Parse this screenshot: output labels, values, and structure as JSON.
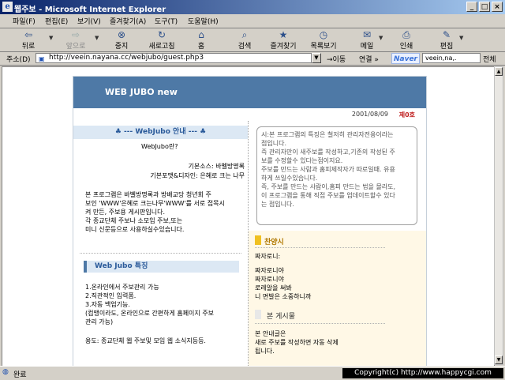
{
  "window": {
    "title": "웹주보 - Microsoft Internet Explorer",
    "minimize": "_",
    "maximize": "□",
    "close": "×"
  },
  "menu": [
    "파일(F)",
    "편집(E)",
    "보기(V)",
    "즐겨찾기(A)",
    "도구(T)",
    "도움말(H)"
  ],
  "toolbar": {
    "back": "뒤로",
    "forward": "앞으로",
    "stop": "중지",
    "refresh": "새로고침",
    "home": "홈",
    "search": "검색",
    "favorites": "즐겨찾기",
    "history": "목록보기",
    "mail": "메일",
    "print": "인쇄",
    "edit": "편집"
  },
  "address": {
    "label": "주소(D)",
    "url": "http://veein.nayana.cc/webjubo/guest.php3",
    "go": "이동",
    "links": "연결 »",
    "naver_logo": "Naver",
    "naver_search": "veein,na,.",
    "all": "전체"
  },
  "page": {
    "banner_title": "WEB JUBO new",
    "date": "2001/08/09",
    "issue": "제0호",
    "left": {
      "heading": "♣ --- WebJubo 안내 --- ♣",
      "question": "WebJubo란?",
      "source": "기본소스: 바벨방명록",
      "font": "기본포맷&디자인: 은혜로 크는 나무",
      "intro": "본 프로그램은 바벨방명록과 방배교당 청년회 주\n보인 'WWW'은혜로 크는나무'WWW'를 서로 접목시\n켜 만든, 주보용 게시판입니다.\n각 종교단체 주보나 소모임 주보,또는\n미니 신문등으로 사용하실수있습니다.",
      "features_heading": "Web Jubo 특징",
      "features": "1.온라인에서 주보관리 가능\n2.직관적인 입력폼.\n3.자동 백업기능.\n(컴맹이라도, 온라인으로 간편하게 홈페이지 주보\n관리 가능)",
      "usage": "용도: 종교단체 웹 주보및 모임 웹 소식지등등."
    },
    "right": {
      "notice": "시:본 프로그램의 특징은 철저히 관리자전용이라는\n점입니다.\n즉 관리자만이 새주보를 작성하고,기존의 작성된 주\n보를 수정할수 있다는점이지요.\n주보를 만드는 사람과 홈피제작자가 따로일때. 유용\n하게 쓰일수있습니다.\n즉, 주보를 만드는 사람이,홈피 만드는 법을 몰라도,\n이 프로그램을 통해 직접 주보를 업데이트할수 있다\n는 점입니다.",
      "praise_label": "찬양시",
      "praise_title": "짜자로니:",
      "praise_body": "짜자로니야\n짜자로니야\n로레알을 써봐\n니 면발은 소중하니까",
      "board_label": "본 게시물",
      "board_body": "본 안내글은\n새로 주보를 작성하면 자동 삭제\n됩니다."
    }
  },
  "status": {
    "text": "완료"
  },
  "copyright": "Copyright(c) http://www.happycgi.com"
}
